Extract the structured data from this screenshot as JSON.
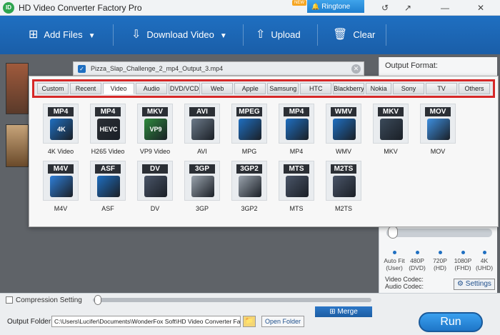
{
  "window": {
    "title": "HD Video Converter Factory Pro",
    "app_icon": "ID",
    "new_badge": "NEW",
    "ringtone_label": "Ringtone Studio",
    "controls": [
      "↺",
      "↗",
      "—",
      "✕"
    ]
  },
  "toolbar": {
    "add_files": "Add Files",
    "download_video": "Download Video",
    "upload": "Upload",
    "clear": "Clear"
  },
  "file_item": {
    "name": "Pizza_Slap_Challenge_2_mp4_Output_3.mp4"
  },
  "format_panel": {
    "tabs": [
      "Custom",
      "Recent",
      "Video",
      "Audio",
      "DVD/VCD",
      "Web",
      "Apple",
      "Samsung",
      "HTC",
      "Blackberry",
      "Nokia",
      "Sony",
      "TV",
      "Others"
    ],
    "active_tab": "Video",
    "formats": [
      {
        "badge": "MP4",
        "name": "4K Video",
        "sub": "4K",
        "color": "#1f6fc1"
      },
      {
        "badge": "MP4",
        "name": "H265 Video",
        "sub": "HEVC",
        "color": "#2b2f35"
      },
      {
        "badge": "MKV",
        "name": "VP9 Video",
        "sub": "VP9",
        "color": "#2e8b3d"
      },
      {
        "badge": "AVI",
        "name": "AVI",
        "sub": "",
        "color": "#6c7a89"
      },
      {
        "badge": "MPEG",
        "name": "MPG",
        "sub": "",
        "color": "#1f6fc1"
      },
      {
        "badge": "MP4",
        "name": "MP4",
        "sub": "",
        "color": "#1f6fc1"
      },
      {
        "badge": "WMV",
        "name": "WMV",
        "sub": "",
        "color": "#1f6fc1"
      },
      {
        "badge": "MKV",
        "name": "MKV",
        "sub": "",
        "color": "#3b4a5a"
      },
      {
        "badge": "MOV",
        "name": "MOV",
        "sub": "",
        "color": "#3d8fe0"
      },
      {
        "badge": "M4V",
        "name": "M4V",
        "sub": "",
        "color": "#2f7fd8"
      },
      {
        "badge": "ASF",
        "name": "ASF",
        "sub": "",
        "color": "#1f6fc1"
      },
      {
        "badge": "DV",
        "name": "DV",
        "sub": "",
        "color": "#4a5568"
      },
      {
        "badge": "3GP",
        "name": "3GP",
        "sub": "",
        "color": "#9aa3ad"
      },
      {
        "badge": "3GP2",
        "name": "3GP2",
        "sub": "",
        "color": "#9aa3ad"
      },
      {
        "badge": "MTS",
        "name": "MTS",
        "sub": "",
        "color": "#4a5568"
      },
      {
        "badge": "M2TS",
        "name": "M2TS",
        "sub": "",
        "color": "#4a5568"
      }
    ]
  },
  "right_panel": {
    "output_format_label": "Output Format:",
    "resolutions": [
      {
        "label": "Auto Fit",
        "sub": "(User)"
      },
      {
        "label": "480P",
        "sub": "(DVD)"
      },
      {
        "label": "720P",
        "sub": "(HD)"
      },
      {
        "label": "1080P",
        "sub": "(FHD)"
      },
      {
        "label": "4K",
        "sub": "(UHD)"
      }
    ],
    "video_codec_label": "Video Codec:",
    "audio_codec_label": "Audio Codec:",
    "settings_label": "Settings"
  },
  "bottom": {
    "compression_label": "Compression Setting",
    "merge_label": "Merge",
    "output_folder_label": "Output Folder:",
    "output_folder_value": "C:\\Users\\Lucifer\\Documents\\WonderFox Soft\\HD Video Converter Factory Pr",
    "open_folder_label": "Open Folder",
    "run_label": "Run"
  }
}
